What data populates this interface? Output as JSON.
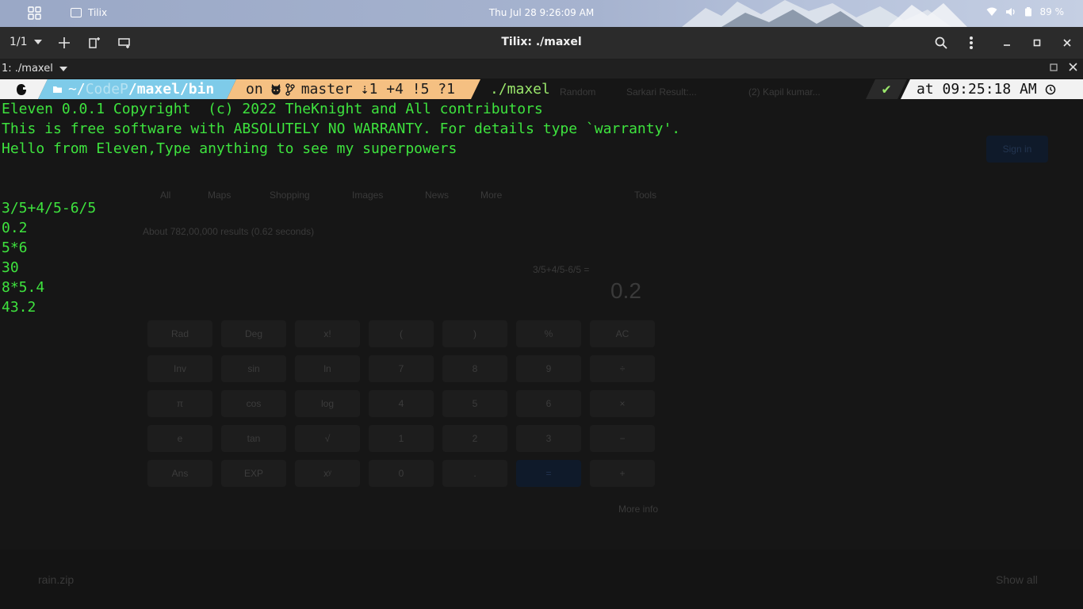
{
  "system": {
    "app_name": "Tilix",
    "clock": "Thu Jul 28   9:26:09 AM",
    "battery": "89 %"
  },
  "titlebar": {
    "session": "1/1",
    "title": "Tilix: ./maxel"
  },
  "terminal_header": {
    "label": "1: ./maxel"
  },
  "prompt": {
    "dir_home": "~/",
    "dir_faded": "CodeP",
    "dir_sep1": "/",
    "dir_maxel": "maxel",
    "dir_sep2": "/",
    "dir_bin": "bin",
    "git_on": "on",
    "git_branch": "master",
    "git_status": "⇣1 +4 !5 ?1",
    "command": "./maxel",
    "status_ok": "✔",
    "time": "at 09:25:18 AM"
  },
  "output": [
    "Eleven 0.0.1 Copyright  (c) 2022 TheKnight and All contributors",
    "This is free software with ABSOLUTELY NO WARRANTY. For details type `warranty'.",
    "Hello from Eleven,Type anything to see my superpowers",
    "",
    "",
    "3/5+4/5-6/5",
    "0.2",
    "5*6",
    "30",
    "8*5.4",
    "43.2"
  ],
  "background_ghost": {
    "tabs": [
      "Random",
      "Sarkari Result:...",
      "(2) Kapil kumar..."
    ],
    "search_tabs": [
      "All",
      "Maps",
      "Shopping",
      "Images",
      "News",
      "More",
      "Tools"
    ],
    "results": "About 782,00,000 results (0.62 seconds)",
    "expr": "3/5+4/5-6/5 =",
    "answer": "0.2",
    "sign_in": "Sign in",
    "more_info": "More info",
    "download": "rain.zip",
    "show_all": "Show all",
    "calc_keys": [
      "Rad",
      "Deg",
      "x!",
      "(",
      ")",
      "%",
      "AC",
      "Inv",
      "sin",
      "ln",
      "7",
      "8",
      "9",
      "÷",
      "π",
      "cos",
      "log",
      "4",
      "5",
      "6",
      "×",
      "e",
      "tan",
      "√",
      "1",
      "2",
      "3",
      "−",
      "Ans",
      "EXP",
      "xʸ",
      "0",
      ".",
      "=",
      "+"
    ]
  },
  "colors": {
    "terminal_green": "#3ee33e",
    "dir_segment": "#7ecbe9",
    "git_segment": "#f5c082"
  }
}
